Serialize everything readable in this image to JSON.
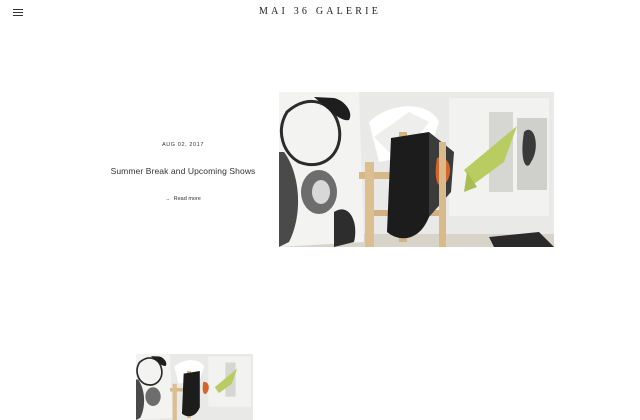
{
  "header": {
    "brand": "MAI 36 GALERIE",
    "menu_icon": "hamburger-menu-icon"
  },
  "posts": [
    {
      "date": "AUG 02, 2017",
      "title": "Summer Break and Upcoming Shows",
      "read_more": "Read more",
      "read_more_icon": "arrow-right-icon"
    }
  ],
  "colors": {
    "background": "#ffffff",
    "text": "#222222",
    "accent_green": "#b9cc62",
    "accent_orange": "#d5652a"
  }
}
